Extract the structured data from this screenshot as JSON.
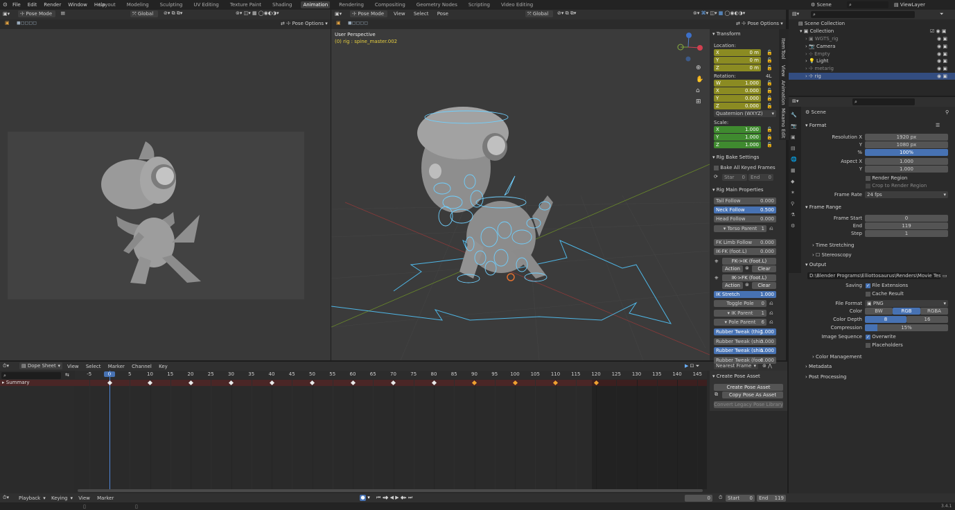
{
  "topbar": {
    "menus": [
      "File",
      "Edit",
      "Render",
      "Window",
      "Help"
    ],
    "workspaces": [
      "Layout",
      "Modeling",
      "Sculpting",
      "UV Editing",
      "Texture Paint",
      "Shading",
      "Animation",
      "Rendering",
      "Compositing",
      "Geometry Nodes",
      "Scripting",
      "Video Editing"
    ],
    "active_workspace": "Animation",
    "scene": "Scene",
    "view_layer": "ViewLayer"
  },
  "left_viewport": {
    "mode": "Pose Mode",
    "orientation": "Global",
    "pose_options": "Pose Options"
  },
  "main_viewport": {
    "mode": "Pose Mode",
    "menu": [
      "View",
      "Select",
      "Pose"
    ],
    "orientation": "Global",
    "pose_options": "Pose Options",
    "title": "User Perspective",
    "subtitle": "(0) rig : spine_master.002"
  },
  "npanel": {
    "tabs": [
      "Item",
      "Tool",
      "View",
      "Animation",
      "Mixamo",
      "Edit"
    ],
    "transform_header": "Transform",
    "location_label": "Location:",
    "location": [
      {
        "axis": "X",
        "value": "0 m"
      },
      {
        "axis": "Y",
        "value": "0 m"
      },
      {
        "axis": "Z",
        "value": "0 m"
      }
    ],
    "rotation_label": "Rotation:",
    "rotation_mode_short": "4L",
    "rotation": [
      {
        "axis": "W",
        "value": "1.000"
      },
      {
        "axis": "X",
        "value": "0.000"
      },
      {
        "axis": "Y",
        "value": "0.000"
      },
      {
        "axis": "Z",
        "value": "0.000"
      }
    ],
    "rotation_mode": "Quaternion (WXYZ)",
    "scale_label": "Scale:",
    "scale": [
      {
        "axis": "X",
        "value": "1.000"
      },
      {
        "axis": "Y",
        "value": "1.000"
      },
      {
        "axis": "Z",
        "value": "1.000"
      }
    ],
    "rig_bake_header": "Rig Bake Settings",
    "bake_all": "Bake All Keyed Frames",
    "star": "Star",
    "star_val": "0",
    "end": "End",
    "end_val": "0",
    "rig_main_header": "Rig Main Properties",
    "props": [
      {
        "label": "Tail Follow",
        "value": "0.000"
      },
      {
        "label": "Neck Follow",
        "value": "0.500"
      },
      {
        "label": "Head Follow",
        "value": "0.000"
      }
    ],
    "torso_parent": "Torso Parent",
    "torso_parent_val": "1",
    "fk_limb_follow": "FK Limb Follow",
    "fk_limb_follow_val": "0.000",
    "ik_fk": "IK-FK (foot.L)",
    "ik_fk_val": "0.000",
    "fk_ik_snap": "FK->IK (foot.L)",
    "ik_fk_snap": "IK->FK (foot.L)",
    "action": "Action",
    "clear": "Clear",
    "ik_stretch": "IK Stretch",
    "ik_stretch_val": "1.000",
    "toggle_pole": "Toggle Pole",
    "toggle_pole_val": "0",
    "ik_parent": "IK Parent",
    "ik_parent_val": "1",
    "pole_parent": "Pole Parent",
    "pole_parent_val": "6",
    "rubber": [
      {
        "label": "Rubber Tweak (thig",
        "value": "1.000"
      },
      {
        "label": "Rubber Tweak (shin.",
        "value": "0.000"
      },
      {
        "label": "Rubber Tweak (shin.",
        "value": "1.000"
      },
      {
        "label": "Rubber Tweak (foot",
        "value": "0.000"
      }
    ]
  },
  "outliner": {
    "root": "Scene Collection",
    "collection": "Collection",
    "items": [
      "WGTS_rig",
      "Camera",
      "Empty",
      "Light",
      "metarig",
      "rig"
    ]
  },
  "properties": {
    "context": "Scene",
    "format_header": "Format",
    "res_x_label": "Resolution X",
    "res_x": "1920 px",
    "res_y_label": "Y",
    "res_y": "1080 px",
    "pct_label": "%",
    "pct": "100%",
    "aspect_x_label": "Aspect X",
    "aspect_x": "1.000",
    "aspect_y_label": "Y",
    "aspect_y": "1.000",
    "render_region": "Render Region",
    "crop_region": "Crop to Render Region",
    "frame_rate_label": "Frame Rate",
    "frame_rate": "24 fps",
    "frame_range_header": "Frame Range",
    "frame_start_label": "Frame Start",
    "frame_start": "0",
    "end_label": "End",
    "end": "119",
    "step_label": "Step",
    "step": "1",
    "time_stretching": "Time Stretching",
    "stereoscopy": "Stereoscopy",
    "output_header": "Output",
    "output_path": "D:\\Blender Programs\\Elliottosaurus\\Renders\\Movie Test Speed\\Walk ...",
    "saving_label": "Saving",
    "file_extensions": "File Extensions",
    "cache_result": "Cache Result",
    "file_format_label": "File Format",
    "file_format": "PNG",
    "color_label": "Color",
    "color_opts": [
      "BW",
      "RGB",
      "RGBA"
    ],
    "color_depth_label": "Color Depth",
    "depth_opts": [
      "8",
      "16"
    ],
    "compression_label": "Compression",
    "compression": "15%",
    "compression_fraction": 0.15,
    "image_sequence_label": "Image Sequence",
    "overwrite": "Overwrite",
    "placeholders": "Placeholders",
    "color_management": "Color Management",
    "metadata": "Metadata",
    "post_processing": "Post Processing"
  },
  "dopesheet": {
    "editor": "Dope Sheet",
    "menu": [
      "View",
      "Select",
      "Marker",
      "Channel",
      "Key"
    ],
    "snap": "Nearest Frame",
    "summary": "Summary",
    "ticks": [
      "-5",
      "0",
      "5",
      "10",
      "15",
      "20",
      "25",
      "30",
      "35",
      "40",
      "45",
      "50",
      "55",
      "60",
      "65",
      "70",
      "75",
      "80",
      "85",
      "90",
      "95",
      "100",
      "105",
      "110",
      "115",
      "120",
      "125",
      "130",
      "135",
      "140",
      "145"
    ],
    "current_frame": "0",
    "keyframes_white": [
      0,
      10,
      20,
      30,
      40,
      50,
      60,
      70,
      80
    ],
    "keyframes_orange": [
      90,
      100,
      110,
      120
    ],
    "pose_panel_header": "Create Pose Asset",
    "create_pose_asset": "Create Pose Asset",
    "copy_pose_asset": "Copy Pose As Asset",
    "convert_legacy": "Convert Legacy Pose Library"
  },
  "timeline": {
    "menu": [
      "Playback",
      "Keying",
      "View",
      "Marker"
    ],
    "frame": "0",
    "start_label": "Start",
    "start": "0",
    "end_label": "End",
    "end": "119"
  },
  "version": "3.4.1"
}
